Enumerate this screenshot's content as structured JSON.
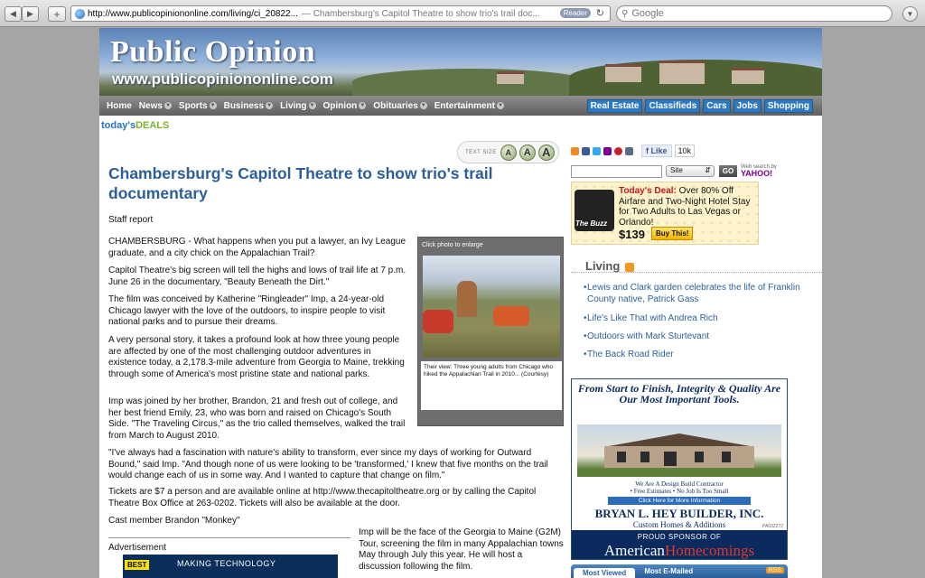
{
  "browser": {
    "url": "http://www.publicopiniononline.com/living/ci_20822...",
    "title": "— Chambersburg's Capitol Theatre to show trio's trail doc...",
    "reader_label": "Reader",
    "search_placeholder": "Google"
  },
  "site": {
    "brand": "Public Opinion",
    "brand_url": "www.publicopiniononline.com",
    "nav": [
      "Home",
      "News",
      "Sports",
      "Business",
      "Living",
      "Opinion",
      "Obituaries",
      "Entertainment"
    ],
    "right_nav": [
      "Real Estate",
      "Classifieds",
      "Cars",
      "Jobs",
      "Shopping"
    ],
    "deals_a": "today's",
    "deals_b": "DEALS"
  },
  "text_size": {
    "label": "TEXT SIZE",
    "buttons": [
      "A",
      "A",
      "A"
    ]
  },
  "article": {
    "headline": "Chambersburg's Capitol Theatre to show trio's trail documentary",
    "byline": "Staff report",
    "paragraphs": [
      "CHAMBERSBURG - What happens when you put a lawyer, an Ivy League graduate, and a city chick on the Appalachian Trail?",
      "Capitol Theatre's big screen will tell the highs and lows of trail life at 7 p.m. June 26 in the documentary, \"Beauty Beneath the Dirt.\"",
      "The film was conceived by Katherine \"Ringleader\" Imp, a 24-year-old Chicago lawyer with the love of the outdoors, to inspire people to visit national parks and to pursue their dreams.",
      "A very personal story, it takes a profound look at how three young people are affected by one of the most challenging outdoor adventures in existence today, a 2,178.3-mile adventure from Georgia to Maine, trekking through some of America's most pristine state and national parks.",
      "Imp was joined by her brother, Brandon, 21 and fresh out of college, and her best friend Emily, 23, who was born and raised on Chicago's South Side. \"The Traveling Circus,\" as the trio called themselves, walked the trail from March to August 2010.",
      "\"I've always had a fascination with nature's ability to transform, ever since my days of working for Outward Bound,\" said Imp. \"And though none of us were looking to be 'transformed,' I knew that five months on the trail would change each of us in some way. And I wanted to capture that change on film.\"",
      "Tickets are $7 a person and are available online at http://www.thecapitoltheatre.org or by calling the Capitol Theatre Box Office at 263-0202. Tickets will also be available at the door.",
      "Cast member Brandon \"Monkey\"",
      "Imp will be the face of the Georgia to Maine (G2M) Tour, screening the film in many Appalachian towns May through July this year. He will host a discussion following the film."
    ],
    "photo_header": "Click photo to enlarge",
    "photo_caption": "Their view: Three young adults from Chicago who hiked the Appalachian Trail in 2010... (Courtesy)",
    "advertisement_label": "Advertisement",
    "ad_logo": "BEST",
    "ad_text": "MAKING TECHNOLOGY"
  },
  "sidebar": {
    "like_label": "Like",
    "like_count": "10k",
    "site_select": "Site",
    "go_label": "GO",
    "web_search": "Web search by",
    "yahoo": "YAHOO!",
    "buzz_label": "The Buzz",
    "deal_red": "Today's Deal:",
    "deal_text": "Over 80% Off Airfare and Two-Night Hotel Stay for Two Adults to Las Vegas or Orlando!",
    "deal_price": "$139",
    "buy_label": "Buy This!",
    "living_title": "Living",
    "living_items": [
      "Lewis and Clark garden celebrates the life of Franklin County native, Patrick Gass",
      "Life's Like That with Andrea Rich",
      "Outdoors with Mark Sturtevant",
      "The Back Road Rider"
    ],
    "ad_head": "From Start to Finish, Integrity & Quality Are Our Most Important Tools.",
    "ad_sub1": "We Are A Design Build Contractor",
    "ad_sub2": "• Free Estimates • No Job Is Too Small",
    "ad_link": "Click Here for More Information",
    "ad_name": "BRYAN L. HEY BUILDER, INC.",
    "ad_tag": "Custom Homes & Additions",
    "ad_code": "PA032272",
    "ad_proud": "PROUD SPONSOR OF",
    "ad_american": "American",
    "ad_homecomings": "Homecomings",
    "tabs": [
      "Most Viewed",
      "Most E-Mailed"
    ],
    "rss_label": "RSS"
  }
}
